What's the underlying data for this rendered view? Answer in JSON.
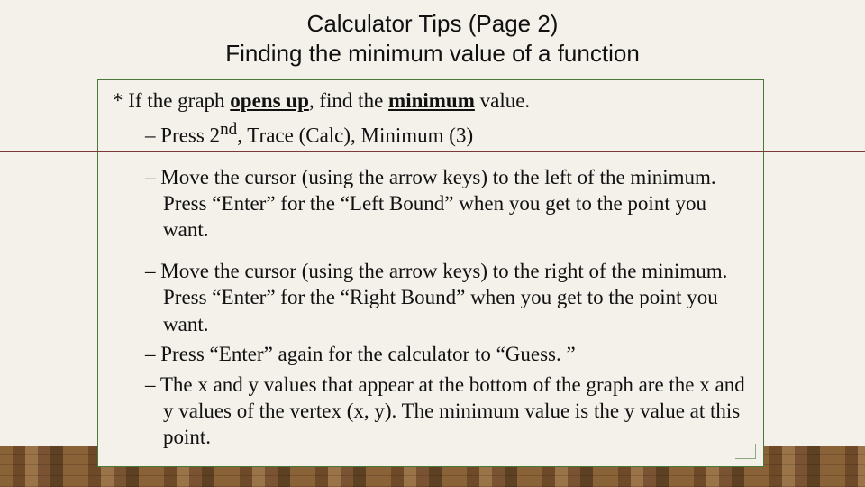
{
  "title": {
    "line1": "Calculator Tips (Page 2)",
    "line2": "Finding the minimum value of a function"
  },
  "intro": {
    "prefix": "* If the graph ",
    "opens_up": "opens up",
    "middle": ", find the ",
    "minimum": "minimum",
    "suffix": " value."
  },
  "steps": {
    "step1": {
      "dash": "– ",
      "pre": "Press 2",
      "sup": "nd",
      "post": ", Trace (Calc), Minimum (3)"
    },
    "step2": "– Move the cursor (using the arrow keys) to the left of the minimum.  Press “Enter” for the “Left Bound” when you get to the point you want.",
    "step3": "– Move the cursor (using the arrow keys) to the right of the minimum.  Press “Enter” for the “Right Bound” when you get to the point you want.",
    "step4": "– Press “Enter” again for the calculator to “Guess. ”",
    "step5": "– The x and y values that appear at the bottom of the graph are the x and y values of the vertex (x, y).   The minimum value is the y value at this point."
  }
}
